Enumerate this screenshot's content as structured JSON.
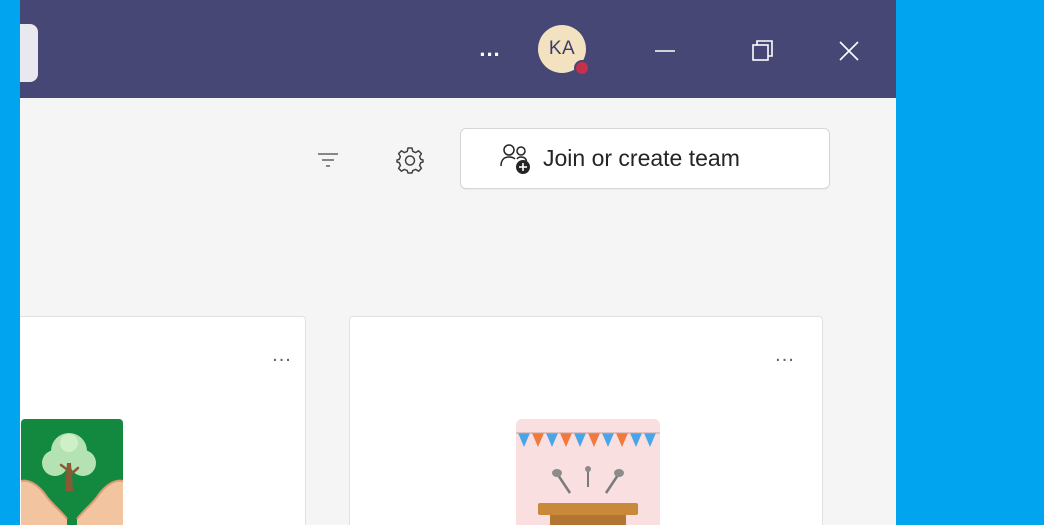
{
  "window": {
    "user_initials": "KA",
    "presence_color": "#c4314b",
    "titlebar_color": "#464775"
  },
  "titlebar": {
    "more_label": "...",
    "icons": {
      "more": "more-horizontal-icon",
      "minimize": "minimize-icon",
      "maximize": "maximize-icon",
      "close": "close-icon"
    }
  },
  "toolbar": {
    "join_label": "Join or create team",
    "icons": {
      "filter": "filter-icon",
      "settings": "gear-icon",
      "join": "people-add-icon"
    }
  },
  "cards": [
    {
      "more_label": "...",
      "image_icon": "tree-in-hands-icon",
      "image_color": "#13893f"
    },
    {
      "more_label": "...",
      "image_icon": "podium-with-bunting-icon",
      "image_color": "#f9dfe0"
    }
  ]
}
